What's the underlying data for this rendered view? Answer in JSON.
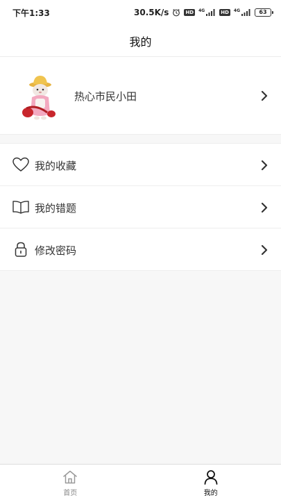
{
  "status_bar": {
    "time": "下午1:33",
    "network_speed": "30.5K/s",
    "alarm_icon": "alarm-icon",
    "hd_badge_1": "HD",
    "net_tag_1": "4G",
    "hd_badge_2": "HD",
    "net_tag_2": "4G",
    "battery": "63"
  },
  "header": {
    "title": "我的"
  },
  "profile": {
    "name": "热心市民小田",
    "avatar_icon": "avatar"
  },
  "menu": {
    "items": [
      {
        "label": "我的收藏",
        "icon": "heart-icon"
      },
      {
        "label": "我的错题",
        "icon": "book-icon"
      },
      {
        "label": "修改密码",
        "icon": "lock-icon"
      }
    ]
  },
  "tab_bar": {
    "tabs": [
      {
        "label": "首页",
        "icon": "home-icon",
        "active": false
      },
      {
        "label": "我的",
        "icon": "user-icon",
        "active": true
      }
    ]
  },
  "colors": {
    "background": "#f7f7f7",
    "card": "#ffffff",
    "divider": "#eeeeee",
    "text_primary": "#333333",
    "tab_inactive": "#888888"
  }
}
